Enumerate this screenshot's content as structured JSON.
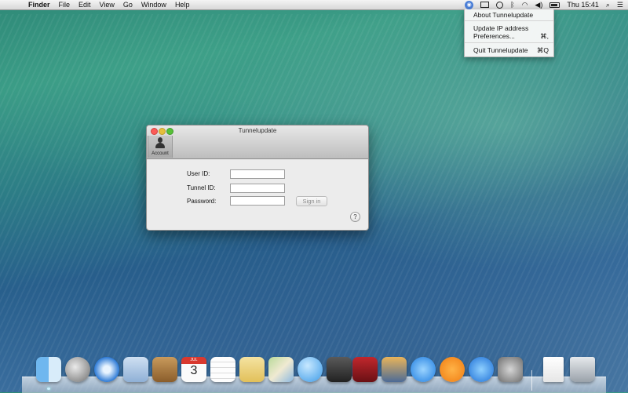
{
  "menubar": {
    "app_name": "Finder",
    "menus": [
      "File",
      "Edit",
      "View",
      "Go",
      "Window",
      "Help"
    ],
    "clock": "Thu 15:41",
    "status_icons": [
      "tunnelupdate-icon",
      "airplay-icon",
      "time-machine-icon",
      "bluetooth-icon",
      "wifi-icon",
      "volume-icon",
      "battery-icon",
      "spotlight-icon",
      "notification-center-icon"
    ]
  },
  "dropdown": {
    "about": "About Tunnelupdate",
    "update_line1": "Update IP address",
    "preferences": "Preferences...",
    "preferences_shortcut": "⌘,",
    "quit": "Quit Tunnelupdate",
    "quit_shortcut": "⌘Q"
  },
  "window": {
    "title": "Tunnelupdate",
    "tab_account": "Account",
    "labels": {
      "user_id": "User ID:",
      "tunnel_id": "Tunnel ID:",
      "password": "Password:"
    },
    "values": {
      "user_id": "",
      "tunnel_id": "",
      "password": ""
    },
    "signin": "Sign in",
    "help": "?"
  },
  "dock": {
    "calendar_month": "JUL",
    "calendar_day": "3",
    "icons": [
      "finder-icon",
      "launchpad-icon",
      "safari-icon",
      "mail-icon",
      "contacts-icon",
      "calendar-icon",
      "reminders-icon",
      "notes-icon",
      "maps-icon",
      "messages-icon",
      "facetime-icon",
      "photo-booth-icon",
      "iphoto-icon",
      "itunes-icon",
      "ibooks-icon",
      "app-store-icon",
      "system-preferences-icon",
      "downloads-stack-icon",
      "trash-icon"
    ]
  }
}
